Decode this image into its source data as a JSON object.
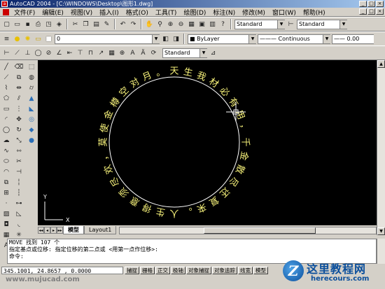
{
  "window": {
    "title": "AutoCAD 2004 - [C:\\WINDOWS\\Desktop\\图形1.dwg]",
    "controls": [
      "_",
      "□",
      "×"
    ]
  },
  "menu": [
    "文件(F)",
    "编辑(E)",
    "视图(V)",
    "插入(I)",
    "格式(O)",
    "工具(T)",
    "绘图(D)",
    "标注(N)",
    "修改(M)",
    "窗口(W)",
    "帮助(H)"
  ],
  "toolbar": {
    "text_style": "Standard",
    "dim_style": "Standard",
    "layer": "0",
    "color": "ByLayer",
    "linetype": "Continuous",
    "lineweight": "0.00",
    "dim_style2": "Standard"
  },
  "drawing": {
    "circle_text": "天生我材必有用，千金散尽还复来。人生得意须尽欢，莫使金樽空对月。",
    "text_color": "#f7f27a",
    "circle_color": "#ffffff",
    "ucs_x": "X",
    "ucs_y": "Y"
  },
  "tabs": [
    "模型",
    "Layout1"
  ],
  "command": {
    "line1": "MOVE 找到 107 个",
    "line2": "指定基点或位移: 指定位移的第二点或 <用第一点作位移>:",
    "line3": "命令:"
  },
  "status": {
    "coords": "345.1001, 24.8657 , 0.0000",
    "buttons": [
      "捕捉",
      "栅格",
      "正交",
      "极轴",
      "对象捕捉",
      "对象追踪",
      "线宽",
      "模型"
    ]
  },
  "watermark": {
    "url": "www.mujucad.com"
  },
  "logo": {
    "title": "这里教程网",
    "subtitle": "herecours.com",
    "badge": "Z"
  }
}
